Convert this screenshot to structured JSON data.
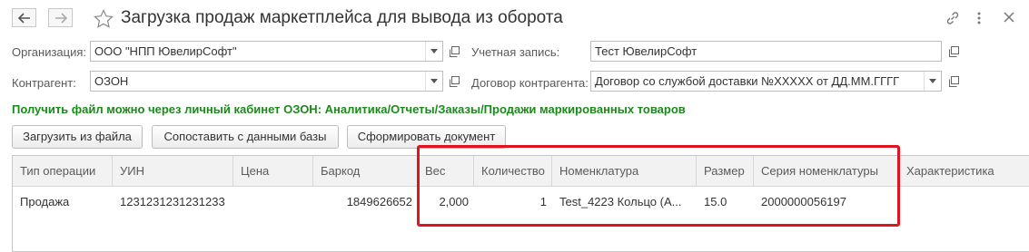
{
  "window": {
    "title": "Загрузка продаж маркетплейса для вывода из оборота"
  },
  "icons": {
    "back": "arrow-left-icon",
    "forward": "arrow-right-icon",
    "favorite": "star-icon",
    "link": "link-icon",
    "menu": "more-vertical-icon",
    "close": "close-icon"
  },
  "form": {
    "organization": {
      "label": "Организация:",
      "value": "ООО \"НПП ЮвелирСофт\""
    },
    "account": {
      "label": "Учетная запись:",
      "value": "Тест ЮвелирСофт"
    },
    "counterparty": {
      "label": "Контрагент:",
      "value": "ОЗОН"
    },
    "contract": {
      "label": "Договор контрагента:",
      "value": "Договор со службой доставки №XXXXX от ДД.ММ.ГГГГ"
    }
  },
  "hint": "Получить файл можно через личный кабинет ОЗОН: Аналитика/Отчеты/Заказы/Продажи маркированных товаров",
  "toolbar": {
    "load_label": "Загрузить из файла",
    "match_label": "Сопоставить с данными базы",
    "create_label": "Сформировать документ"
  },
  "table": {
    "columns": [
      "Тип операции",
      "УИН",
      "Цена",
      "Баркод",
      "Вес",
      "Количество",
      "Номенклатура",
      "Размер",
      "Серия номенклатуры",
      "Характеристика"
    ],
    "rows": [
      {
        "operation": "Продажа",
        "uin": "1231231231231233",
        "price": "",
        "barcode": "1849626652",
        "weight": "2,000",
        "quantity": "1",
        "item": "Test_4223 Кольцо (А...",
        "size": "15.0",
        "series": "2000000056197",
        "characteristic": ""
      }
    ]
  },
  "colors": {
    "hint_green": "#1a8a1a",
    "highlight_red": "#e0141e"
  }
}
